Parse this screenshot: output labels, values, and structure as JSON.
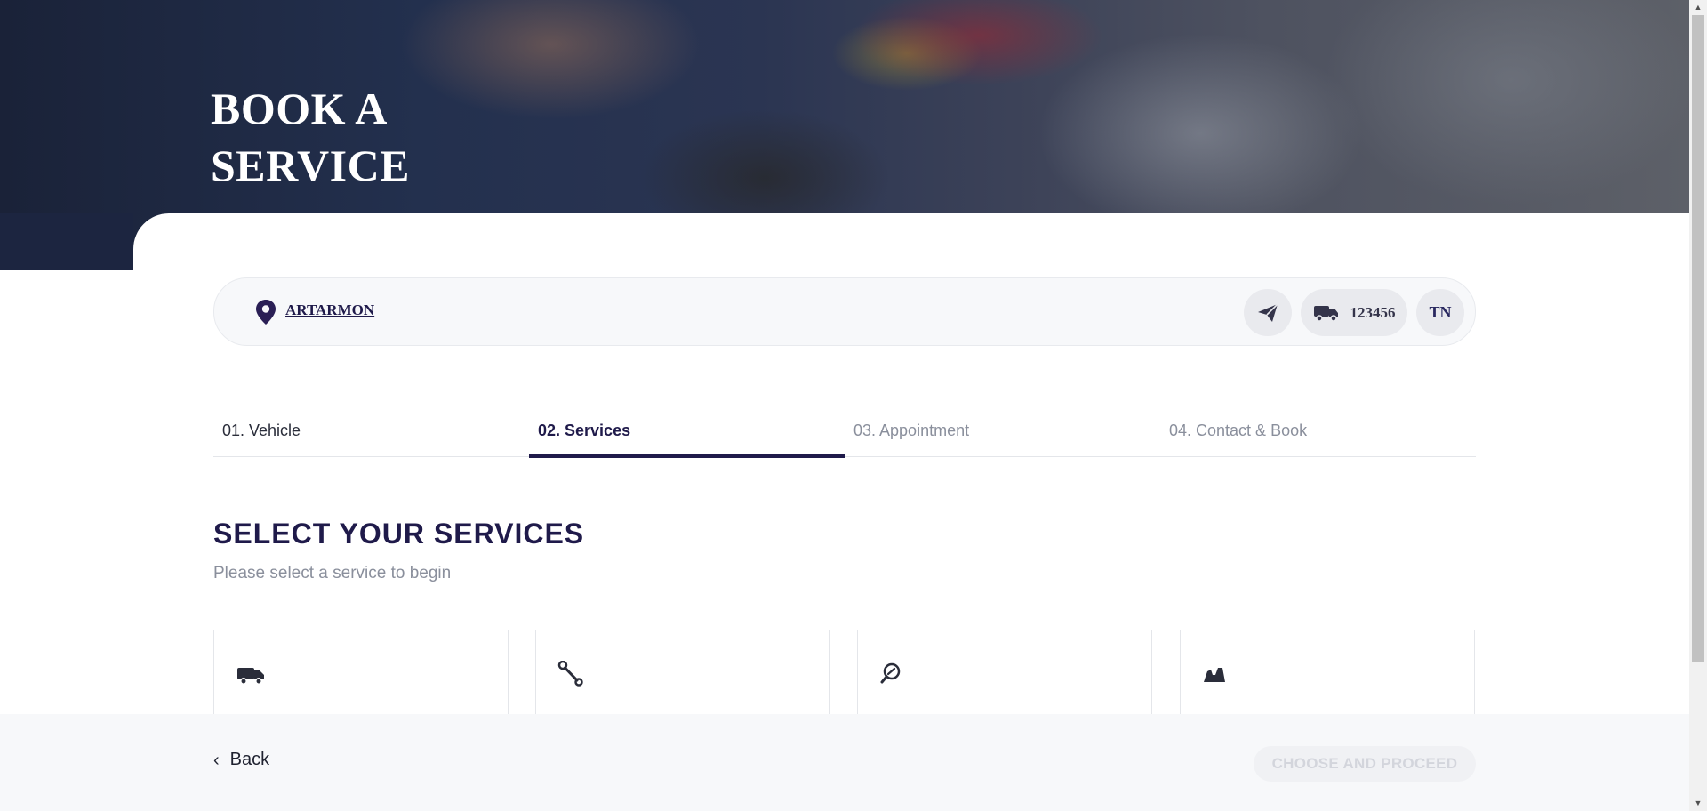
{
  "hero": {
    "title_line1": "BOOK A",
    "title_line2": "SERVICE"
  },
  "info_bar": {
    "location": "ARTARMON",
    "vehicle_id": "123456",
    "user_initials": "TN",
    "icons": [
      "map-pin-icon",
      "send-icon",
      "truck-icon"
    ]
  },
  "steps": [
    {
      "label": "01. Vehicle",
      "state": "done"
    },
    {
      "label": "02. Services",
      "state": "active"
    },
    {
      "label": "03. Appointment",
      "state": "pending"
    },
    {
      "label": "04. Contact & Book",
      "state": "pending"
    }
  ],
  "section": {
    "title": "SELECT YOUR SERVICES",
    "subtitle": "Please select a service to begin"
  },
  "cards": [
    {
      "icon": "truck-icon"
    },
    {
      "icon": "wrench-icon"
    },
    {
      "icon": "inspection-icon"
    },
    {
      "icon": "car-seat-icon"
    }
  ],
  "footer": {
    "back_label": "Back",
    "proceed_label": "CHOOSE AND PROCEED",
    "proceed_enabled": false
  },
  "colors": {
    "brand_navy": "#1f1a4a",
    "muted_text": "#8a8f9c",
    "footer_bg": "#f7f8fa"
  }
}
